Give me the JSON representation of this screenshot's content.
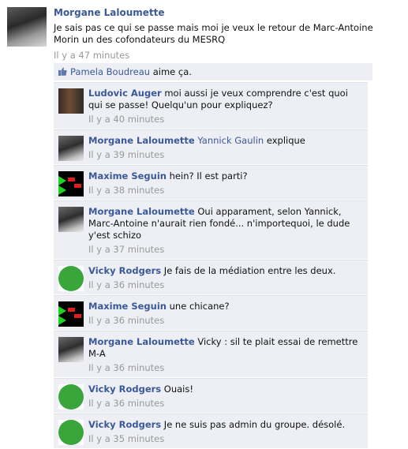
{
  "post": {
    "author": "Morgane Laloumette",
    "text": "Je sais pas ce qui se passe mais moi je veux le retour de Marc-Antoine Morin un des cofondateurs du MESRQ",
    "time": "Il y a 47 minutes"
  },
  "likes": {
    "name": "Pamela Boudreau",
    "suffix": " aime ça."
  },
  "comments": [
    {
      "name": "Ludovic Auger",
      "text": "moi aussi je veux comprendre c'est quoi qui se passe! Quelqu'un pour expliquez?",
      "time": "Il y a 40 minutes",
      "avatar": "photo-gym"
    },
    {
      "name": "Morgane Laloumette",
      "mention": "Yannick Gaulin",
      "text": " explique",
      "time": "Il y a 39 minutes",
      "avatar": "photo-portrait"
    },
    {
      "name": "Maxime Seguin",
      "text": "hein? Il est parti?",
      "time": "Il y a 38 minutes",
      "avatar": "dark-green-red"
    },
    {
      "name": "Morgane Laloumette",
      "text": "Oui apparament, selon Yannick, Marc-Antoine n'aurait rien fondé... n'importequoi, le dude y'est schizo",
      "time": "Il y a 37 minutes",
      "avatar": "photo-portrait"
    },
    {
      "name": "Vicky Rodgers",
      "text": "Je fais de la médiation entre les deux.",
      "time": "Il y a 36 minutes",
      "avatar": "green-circle"
    },
    {
      "name": "Maxime Seguin",
      "text": "une chicane?",
      "time": "Il y a 36 minutes",
      "avatar": "dark-green-red"
    },
    {
      "name": "Morgane Laloumette",
      "text": "Vicky : sil te plait essai de remettre M-A",
      "time": "Il y a 36 minutes",
      "avatar": "photo-portrait"
    },
    {
      "name": "Vicky Rodgers",
      "text": "Ouais!",
      "time": "Il y a 36 minutes",
      "avatar": "green-circle"
    },
    {
      "name": "Vicky Rodgers",
      "text": "Je ne suis pas admin du groupe. désolé.",
      "time": "Il y a 35 minutes",
      "avatar": "green-circle"
    }
  ],
  "colors": {
    "link": "#3b5998",
    "panel": "#edeff4",
    "meta": "#999999"
  }
}
